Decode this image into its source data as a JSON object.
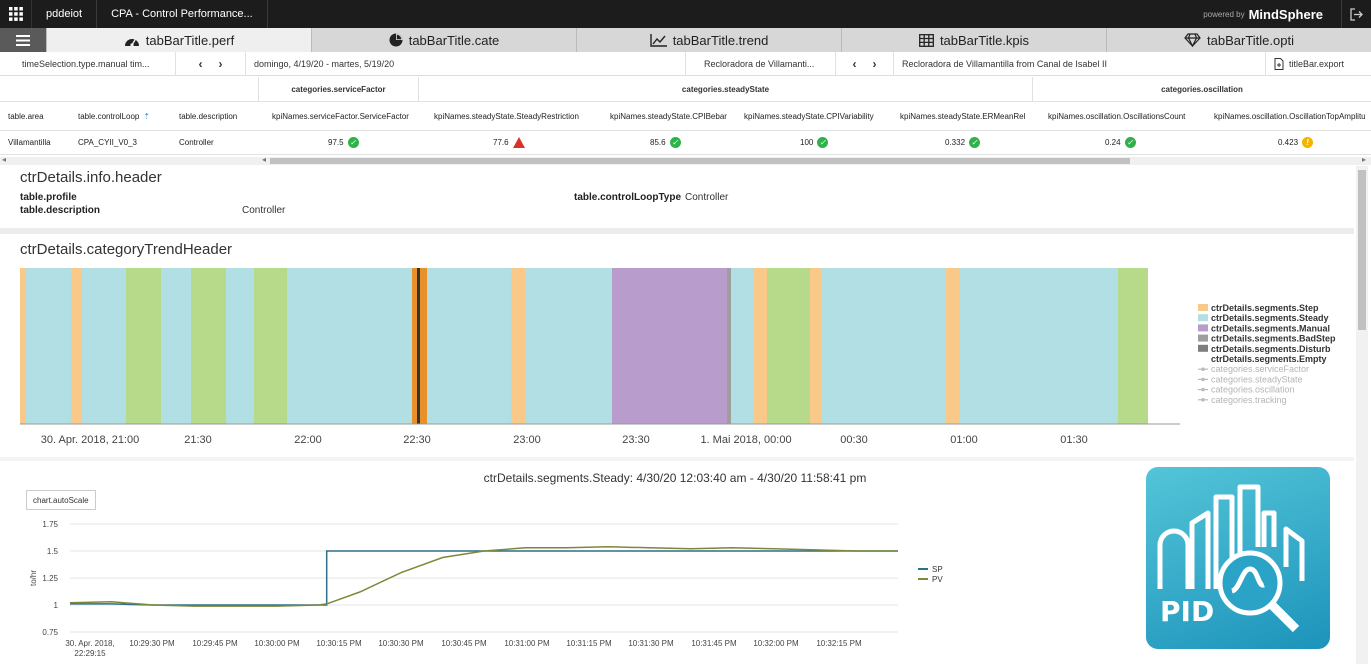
{
  "topbar": {
    "app_short": "pddeiot",
    "app_title": "CPA - Control Performance...",
    "powered_by": "powered by",
    "brand": "MindSphere"
  },
  "tabs": [
    {
      "label": "tabBarTitle.perf",
      "icon": "speedometer-icon",
      "active": true
    },
    {
      "label": "tabBarTitle.cate",
      "icon": "pie-chart-icon",
      "active": false
    },
    {
      "label": "tabBarTitle.trend",
      "icon": "line-chart-icon",
      "active": false
    },
    {
      "label": "tabBarTitle.kpis",
      "icon": "table-icon",
      "active": false
    },
    {
      "label": "tabBarTitle.opti",
      "icon": "diamond-icon",
      "active": false
    }
  ],
  "selection": {
    "time_type": "timeSelection.type.manual tim...",
    "date_range": "domingo, 4/19/20 - martes, 5/19/20",
    "asset_short": "Recloradora de Villamanti...",
    "asset_full": "Recloradora de Villamantilla from Canal de Isabel II",
    "export_label": "titleBar.export"
  },
  "kpi_table": {
    "groups": [
      "categories.serviceFactor",
      "categories.steadyState",
      "categories.oscillation"
    ],
    "columns": [
      "table.area",
      "table.controlLoop",
      "table.description",
      "kpiNames.serviceFactor.ServiceFactor",
      "kpiNames.steadyState.SteadyRestriction",
      "kpiNames.steadyState.CPIBebar",
      "kpiNames.steadyState.CPIVariability",
      "kpiNames.steadyState.ERMeanRel",
      "kpiNames.oscillation.OscillationsCount",
      "kpiNames.oscillation.OscillationTopAmplitu"
    ],
    "row": {
      "area": "Villamantilla",
      "loop": "CPA_CYII_V0_3",
      "description": "Controller",
      "values": [
        {
          "value": "97.5",
          "status": "ok"
        },
        {
          "value": "77.6",
          "status": "alarm"
        },
        {
          "value": "85.6",
          "status": "ok"
        },
        {
          "value": "100",
          "status": "ok"
        },
        {
          "value": "0.332",
          "status": "ok"
        },
        {
          "value": "0.24",
          "status": "ok"
        },
        {
          "value": "0.423",
          "status": "warning"
        }
      ]
    }
  },
  "info": {
    "header": "ctrDetails.info.header",
    "profile_label": "table.profile",
    "description_label": "table.description",
    "description_value": "Controller",
    "loop_type_label": "table.controlLoopType",
    "loop_type_value": "Controller"
  },
  "category_trend": {
    "header": "ctrDetails.categoryTrendHeader",
    "colors": {
      "Step": "#f9c98a",
      "Steady": "#b2dfe3",
      "Manual": "#b89ccb",
      "BadStep": "#9e9e9e",
      "Disturb": "#8a8a8a",
      "Tracking": "#b6d98a",
      "Highlight": "#e8912b"
    },
    "legend": [
      {
        "label": "ctrDetails.segments.Step",
        "color": "#f9c98a",
        "muted": false
      },
      {
        "label": "ctrDetails.segments.Steady",
        "color": "#b2dfe3",
        "muted": false
      },
      {
        "label": "ctrDetails.segments.Manual",
        "color": "#b89ccb",
        "muted": false
      },
      {
        "label": "ctrDetails.segments.BadStep",
        "color": "#9e9e9e",
        "muted": false
      },
      {
        "label": "ctrDetails.segments.Disturb",
        "color": "#7e7e7e",
        "muted": false
      },
      {
        "label": "ctrDetails.segments.Empty",
        "color": "",
        "muted": false
      },
      {
        "label": "categories.serviceFactor",
        "color": "#bbbbbb",
        "muted": true
      },
      {
        "label": "categories.steadyState",
        "color": "#bbbbbb",
        "muted": true
      },
      {
        "label": "categories.oscillation",
        "color": "#bbbbbb",
        "muted": true
      },
      {
        "label": "categories.tracking",
        "color": "#bbbbbb",
        "muted": true
      }
    ],
    "ticks": [
      "30. Apr. 2018, 21:00",
      "21:30",
      "22:00",
      "22:30",
      "23:00",
      "23:30",
      "1. Mai 2018, 00:00",
      "00:30",
      "01:00",
      "01:30"
    ]
  },
  "chart_data": {
    "type": "line",
    "title": "ctrDetails.segments.Steady: 4/30/20 12:03:40 am - 4/30/20 11:58:41 pm",
    "autoscale_label": "chart.autoScale",
    "ylabel": "to/hr",
    "ylim": [
      0.75,
      1.6
    ],
    "yticks": [
      "1.75",
      "1.5",
      "1.25",
      "1",
      "0.75"
    ],
    "xticks": [
      "30. Apr. 2018, 22:29:15",
      "10:29:30 PM",
      "10:29:45 PM",
      "10:30:00 PM",
      "10:30:15 PM",
      "10:30:30 PM",
      "10:30:45 PM",
      "10:31:00 PM",
      "10:31:15 PM",
      "10:31:30 PM",
      "10:31:45 PM",
      "10:32:00 PM",
      "10:32:15 PM"
    ],
    "x_seconds": [
      0,
      10,
      20,
      30,
      40,
      50,
      60,
      62,
      70,
      80,
      90,
      100,
      110,
      120,
      130,
      140,
      150,
      160,
      170,
      180,
      190,
      200
    ],
    "series": [
      {
        "name": "SP",
        "color": "#2f6f8a",
        "values": [
          1.01,
          1.01,
          1.0,
          1.0,
          1.0,
          1.0,
          1.0,
          1.5,
          1.5,
          1.5,
          1.5,
          1.5,
          1.5,
          1.5,
          1.5,
          1.5,
          1.5,
          1.5,
          1.5,
          1.5,
          1.5,
          1.5
        ]
      },
      {
        "name": "PV",
        "color": "#7a8a3a",
        "values": [
          1.02,
          1.03,
          1.0,
          0.99,
          0.99,
          0.99,
          1.0,
          1.01,
          1.12,
          1.3,
          1.44,
          1.5,
          1.53,
          1.53,
          1.54,
          1.53,
          1.52,
          1.53,
          1.52,
          1.51,
          1.5,
          1.5
        ]
      }
    ]
  },
  "pid_logo_text": "PID"
}
